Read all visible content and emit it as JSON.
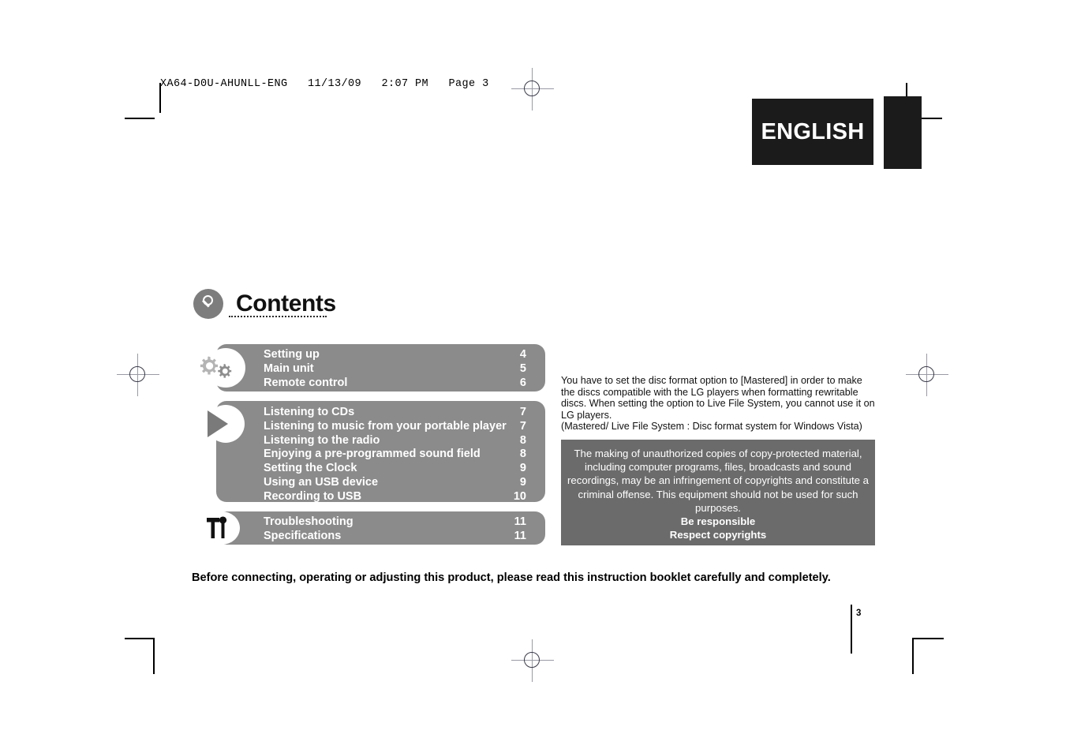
{
  "print_slug": "XA64-D0U-AHUNLL-ENG   11/13/09   2:07 PM   Page 3",
  "language_tab": {
    "label": "ENGLISH"
  },
  "contents": {
    "title": "Contents",
    "icon": "magnifier-icon",
    "sections": [
      {
        "icon": "gears-icon",
        "entries": [
          {
            "label": "Setting up",
            "page": "4"
          },
          {
            "label": "Main unit",
            "page": "5"
          },
          {
            "label": "Remote control",
            "page": "6"
          }
        ]
      },
      {
        "icon": "play-triangle-icon",
        "entries": [
          {
            "label": "Listening to CDs",
            "page": "7"
          },
          {
            "label": "Listening to music from your portable player",
            "page": "7"
          },
          {
            "label": "Listening to the radio",
            "page": "8"
          },
          {
            "label": "Enjoying a pre-programmed sound field",
            "page": "8"
          },
          {
            "label": "Setting the Clock",
            "page": "9"
          },
          {
            "label": "Using an USB device",
            "page": "9"
          },
          {
            "label": "Recording to USB",
            "page": "10"
          }
        ]
      },
      {
        "icon": "tools-icon",
        "entries": [
          {
            "label": "Troubleshooting",
            "page": "11"
          },
          {
            "label": "Specifications",
            "page": "11"
          }
        ]
      }
    ]
  },
  "disc_format_note": "You have to set the disc format option to [Mastered] in order to make the discs compatible with the LG players when formatting rewritable discs. When setting the option to Live File System, you cannot use it on LG players.\n(Mastered/ Live File System : Disc format system for Windows Vista)",
  "copyright_box": {
    "body": "The making of unauthorized copies of copy-protected material, including computer programs, files, broadcasts and sound recordings, may be an infringement of copyrights and constitute a criminal offense. This equipment should not be used for such purposes.",
    "line1": "Be responsible",
    "line2": "Respect copyrights"
  },
  "bottom_notice": "Before connecting, operating or adjusting this product, please read this instruction booklet carefully and completely.",
  "folio": "3",
  "colors": {
    "bar_gray": "#8b8b8b",
    "copy_box_gray": "#6b6b6b",
    "tab_black": "#1b1b1b",
    "icon_circle_gray": "#7d7d7d"
  }
}
